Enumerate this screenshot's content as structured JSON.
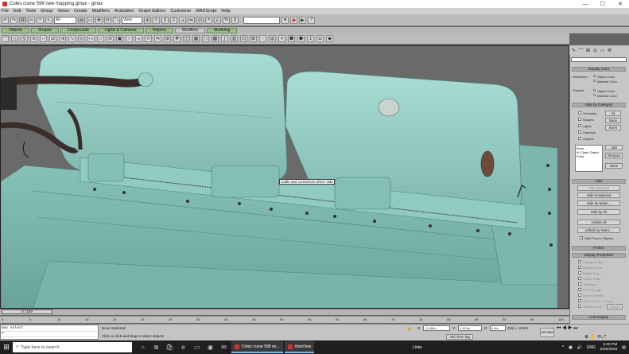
{
  "window": {
    "title": "Coles crane 598 new mapping.gmax - gmax",
    "min": "—",
    "max": "☐",
    "close": "✕"
  },
  "menu": [
    "File",
    "Edit",
    "Tools",
    "Group",
    "Views",
    "Create",
    "Modifiers",
    "Animation",
    "Graph Editors",
    "Customize",
    "MAXScript",
    "Help"
  ],
  "toolbar": {
    "selection_filter": "All",
    "ref_coord": "View"
  },
  "tabs": [
    "Objects",
    "Shapes",
    "Compounds",
    "Lights & Cameras",
    "Helpers",
    "Modifiers",
    "Modeling"
  ],
  "active_tab": "Modifiers",
  "viewport": {
    "tooltip": "Cable and connectors driver side"
  },
  "panel": {
    "display_color": {
      "title": "Display Color",
      "wireframe_label": "Wireframe:",
      "shaded_label": "Shaded:",
      "object_color": "Object Color",
      "material_color": "Material Color"
    },
    "hide_by_category": {
      "title": "Hide by Category",
      "items": [
        "Geometry",
        "Shapes",
        "Lights",
        "Cameras",
        "Helpers"
      ],
      "all": "All",
      "none": "None",
      "invert": "Invert",
      "list": [
        "Bone",
        "IK Chain Object",
        "Point"
      ],
      "add": "Add",
      "remove": "Remove",
      "list_none": "None"
    },
    "hide": {
      "title": "Hide",
      "buttons": [
        "Hide Selected",
        "Hide Unselected",
        "Hide by Name...",
        "Hide by Hit",
        "Unhide All",
        "Unhide by Name...",
        "Hide Frozen Objects"
      ]
    },
    "freeze": {
      "title": "Freeze"
    },
    "display_properties": {
      "title": "Display Properties",
      "items": [
        "Display as Box",
        "Backface Cull",
        "Edges Only",
        "Vertex Ticks",
        "Trajectory",
        "See-Through",
        "Ignore Extents",
        "Show Frozen in Gray",
        "Vertex Colors"
      ],
      "shaded_btn": "Shaded"
    },
    "link_display": {
      "title": "Link Display"
    }
  },
  "timeline": {
    "label": "0 / 100",
    "ticks": [
      "0",
      "5",
      "10",
      "15",
      "20",
      "25",
      "30",
      "35",
      "40",
      "45",
      "50",
      "55",
      "60",
      "65",
      "70",
      "75",
      "80",
      "85",
      "90",
      "95",
      "100"
    ]
  },
  "status": {
    "maxscript_lines": [
      "max select",
      "#"
    ],
    "none_selected": "None Selected",
    "prompt": "Click or click-and-drag to select objects",
    "add_time_tag": "Add Time Tag",
    "x_label": "X:",
    "x_value": "-2.945m",
    "y_label": "Y:",
    "y_value": "0.414m",
    "z_label": "Z:",
    "z_value": "0.0m",
    "grid": "Grid = 10.0m",
    "animate": "Animate"
  },
  "taskbar": {
    "search": "Type here to search",
    "apps": [
      "Coles crane 598 ne...",
      "IrfanView"
    ],
    "links": "Links",
    "lang": "ENG",
    "time": "5:30 PM",
    "date": "6/30/2020"
  },
  "colors": {
    "mesh": "#8fc6bd",
    "mesh_dark": "#5f9690",
    "background": "#6a6a6a",
    "tab_green": "#9ebd8a"
  }
}
